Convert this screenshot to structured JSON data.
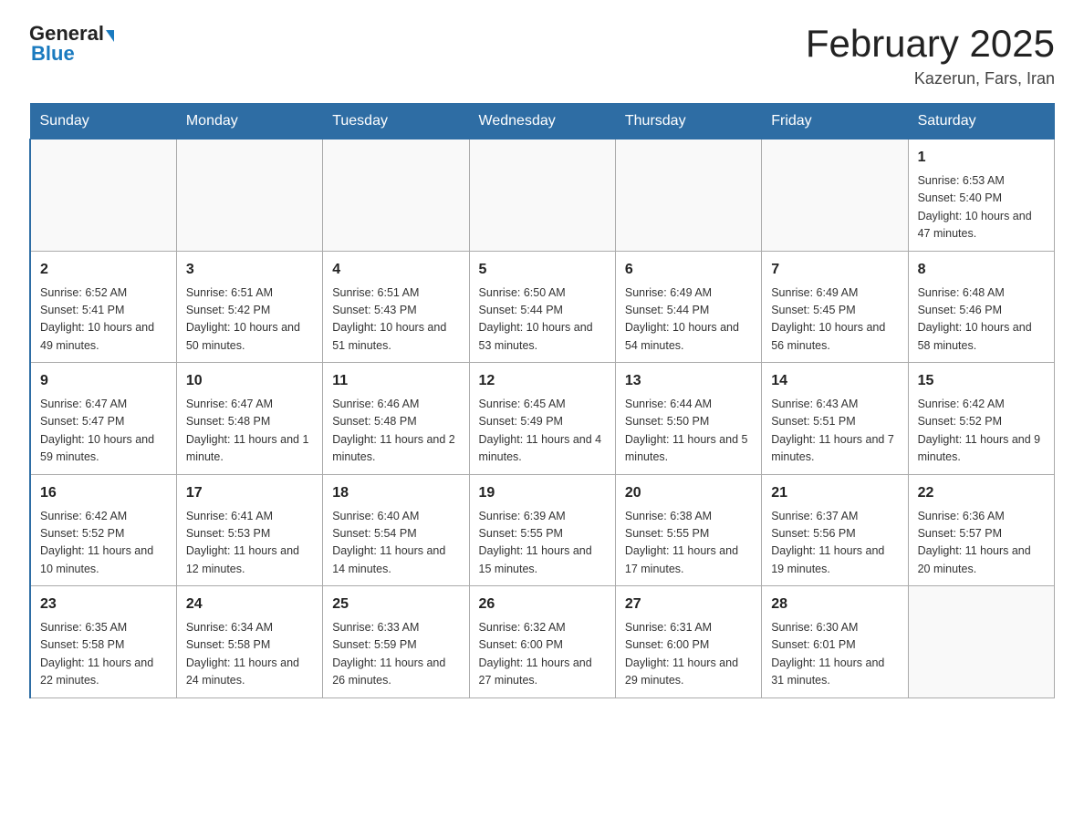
{
  "logo": {
    "general": "General",
    "triangle": "▶",
    "blue": "Blue"
  },
  "header": {
    "title": "February 2025",
    "subtitle": "Kazerun, Fars, Iran"
  },
  "days_of_week": [
    "Sunday",
    "Monday",
    "Tuesday",
    "Wednesday",
    "Thursday",
    "Friday",
    "Saturday"
  ],
  "weeks": [
    [
      null,
      null,
      null,
      null,
      null,
      null,
      {
        "date": "1",
        "sunrise": "6:53 AM",
        "sunset": "5:40 PM",
        "daylight": "10 hours and 47 minutes."
      }
    ],
    [
      {
        "date": "2",
        "sunrise": "6:52 AM",
        "sunset": "5:41 PM",
        "daylight": "10 hours and 49 minutes."
      },
      {
        "date": "3",
        "sunrise": "6:51 AM",
        "sunset": "5:42 PM",
        "daylight": "10 hours and 50 minutes."
      },
      {
        "date": "4",
        "sunrise": "6:51 AM",
        "sunset": "5:43 PM",
        "daylight": "10 hours and 51 minutes."
      },
      {
        "date": "5",
        "sunrise": "6:50 AM",
        "sunset": "5:44 PM",
        "daylight": "10 hours and 53 minutes."
      },
      {
        "date": "6",
        "sunrise": "6:49 AM",
        "sunset": "5:44 PM",
        "daylight": "10 hours and 54 minutes."
      },
      {
        "date": "7",
        "sunrise": "6:49 AM",
        "sunset": "5:45 PM",
        "daylight": "10 hours and 56 minutes."
      },
      {
        "date": "8",
        "sunrise": "6:48 AM",
        "sunset": "5:46 PM",
        "daylight": "10 hours and 58 minutes."
      }
    ],
    [
      {
        "date": "9",
        "sunrise": "6:47 AM",
        "sunset": "5:47 PM",
        "daylight": "10 hours and 59 minutes."
      },
      {
        "date": "10",
        "sunrise": "6:47 AM",
        "sunset": "5:48 PM",
        "daylight": "11 hours and 1 minute."
      },
      {
        "date": "11",
        "sunrise": "6:46 AM",
        "sunset": "5:48 PM",
        "daylight": "11 hours and 2 minutes."
      },
      {
        "date": "12",
        "sunrise": "6:45 AM",
        "sunset": "5:49 PM",
        "daylight": "11 hours and 4 minutes."
      },
      {
        "date": "13",
        "sunrise": "6:44 AM",
        "sunset": "5:50 PM",
        "daylight": "11 hours and 5 minutes."
      },
      {
        "date": "14",
        "sunrise": "6:43 AM",
        "sunset": "5:51 PM",
        "daylight": "11 hours and 7 minutes."
      },
      {
        "date": "15",
        "sunrise": "6:42 AM",
        "sunset": "5:52 PM",
        "daylight": "11 hours and 9 minutes."
      }
    ],
    [
      {
        "date": "16",
        "sunrise": "6:42 AM",
        "sunset": "5:52 PM",
        "daylight": "11 hours and 10 minutes."
      },
      {
        "date": "17",
        "sunrise": "6:41 AM",
        "sunset": "5:53 PM",
        "daylight": "11 hours and 12 minutes."
      },
      {
        "date": "18",
        "sunrise": "6:40 AM",
        "sunset": "5:54 PM",
        "daylight": "11 hours and 14 minutes."
      },
      {
        "date": "19",
        "sunrise": "6:39 AM",
        "sunset": "5:55 PM",
        "daylight": "11 hours and 15 minutes."
      },
      {
        "date": "20",
        "sunrise": "6:38 AM",
        "sunset": "5:55 PM",
        "daylight": "11 hours and 17 minutes."
      },
      {
        "date": "21",
        "sunrise": "6:37 AM",
        "sunset": "5:56 PM",
        "daylight": "11 hours and 19 minutes."
      },
      {
        "date": "22",
        "sunrise": "6:36 AM",
        "sunset": "5:57 PM",
        "daylight": "11 hours and 20 minutes."
      }
    ],
    [
      {
        "date": "23",
        "sunrise": "6:35 AM",
        "sunset": "5:58 PM",
        "daylight": "11 hours and 22 minutes."
      },
      {
        "date": "24",
        "sunrise": "6:34 AM",
        "sunset": "5:58 PM",
        "daylight": "11 hours and 24 minutes."
      },
      {
        "date": "25",
        "sunrise": "6:33 AM",
        "sunset": "5:59 PM",
        "daylight": "11 hours and 26 minutes."
      },
      {
        "date": "26",
        "sunrise": "6:32 AM",
        "sunset": "6:00 PM",
        "daylight": "11 hours and 27 minutes."
      },
      {
        "date": "27",
        "sunrise": "6:31 AM",
        "sunset": "6:00 PM",
        "daylight": "11 hours and 29 minutes."
      },
      {
        "date": "28",
        "sunrise": "6:30 AM",
        "sunset": "6:01 PM",
        "daylight": "11 hours and 31 minutes."
      },
      null
    ]
  ],
  "labels": {
    "sunrise": "Sunrise:",
    "sunset": "Sunset:",
    "daylight": "Daylight:"
  }
}
